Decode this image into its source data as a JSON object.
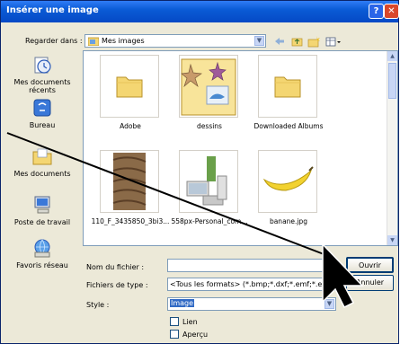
{
  "window": {
    "title": "Insérer une image",
    "help_label": "?",
    "close_label": "✕"
  },
  "toolbar": {
    "look_in_label": "Regarder dans :",
    "location": "Mes images"
  },
  "places": [
    {
      "label": "Mes documents récents",
      "icon": "recent-docs-icon"
    },
    {
      "label": "Bureau",
      "icon": "desktop-icon"
    },
    {
      "label": "Mes documents",
      "icon": "my-documents-icon"
    },
    {
      "label": "Poste de travail",
      "icon": "my-computer-icon"
    },
    {
      "label": "Favoris réseau",
      "icon": "network-places-icon"
    }
  ],
  "files": [
    {
      "name": "Adobe",
      "type": "folder"
    },
    {
      "name": "dessins",
      "type": "folder-with-images"
    },
    {
      "name": "Downloaded Albums",
      "type": "folder"
    },
    {
      "name": "110_F_3435850_3bi3...",
      "type": "image"
    },
    {
      "name": "558px-Personal_com...",
      "type": "image"
    },
    {
      "name": "banane.jpg",
      "type": "image"
    }
  ],
  "form": {
    "filename_label": "Nom du fichier :",
    "filename_value": "",
    "filetype_label": "Fichiers de type :",
    "filetype_value": "<Tous les formats> (*.bmp;*.dxf;*.emf;*.eps;*.gif",
    "style_label": "Style :",
    "style_value": "Image",
    "link_label": "Lien",
    "preview_label": "Aperçu"
  },
  "buttons": {
    "open": "Ouvrir",
    "cancel": "Annuler"
  },
  "colors": {
    "title_bar": "#0a5bd6",
    "window_bg": "#ece9d8",
    "selection": "#316ac5"
  }
}
